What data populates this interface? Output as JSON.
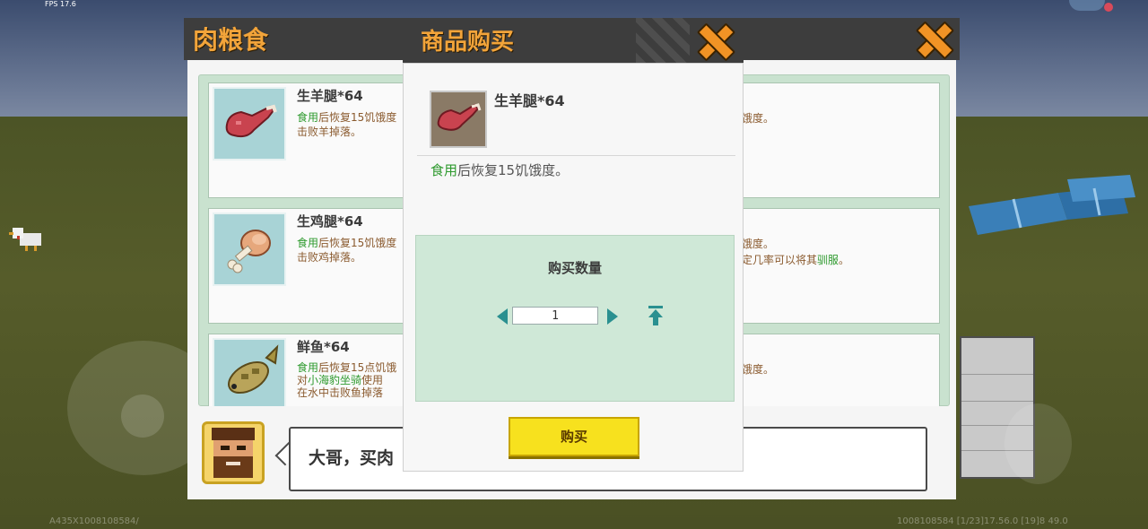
{
  "hud": {
    "fps": "FPS 17.6",
    "coords_left": "A435X1008108584/",
    "coords_right": "1008108584   [1/23]17.56.0   [19]8 49.0"
  },
  "shop": {
    "title": "肉粮食",
    "items": [
      {
        "name": "生羊腿*64",
        "desc_use": "食用",
        "desc_rest": "后恢复15饥饿度",
        "desc_line2": "击败羊掉落。"
      },
      {
        "name": "生鸡腿*64",
        "desc_use": "食用",
        "desc_rest": "后恢复15饥饿度",
        "desc_line2": "击败鸡掉落。"
      },
      {
        "name": "鲜鱼*64",
        "desc_use": "食用",
        "desc_rest": "后恢复15点饥饿",
        "desc_line2_prefix": "对",
        "desc_line2_green": "小海豹坐骑",
        "desc_line2_rest": "使用",
        "desc_line3": "在水中击败鱼掉落"
      }
    ],
    "right_column": {
      "r1": "饥饿度。",
      "r2a": "饥饿度。",
      "r2b_prefix": "一定几率可以将其",
      "r2b_green": "驯服",
      "r2b_suffix": "。",
      "r2c": "。",
      "r3": "饥饿度。"
    },
    "npc_dialog": "大哥，买肉"
  },
  "purchase": {
    "title": "商品购买",
    "item_name": "生羊腿*64",
    "desc_use": "食用",
    "desc_rest": "后恢复15饥饿度。",
    "qty_label": "购买数量",
    "qty_value": "1",
    "buy_label": "购买"
  },
  "colors": {
    "title_orange": "#f2a43a",
    "highlight_green": "#2e9a2e",
    "buy_yellow": "#f7e11e",
    "panel_green": "#cfe8d7"
  },
  "icons": [
    "close-icon",
    "lamb-leg-icon",
    "chicken-leg-icon",
    "fish-icon",
    "npc-portrait",
    "decrease-arrow-icon",
    "increase-arrow-icon",
    "max-quantity-icon"
  ]
}
